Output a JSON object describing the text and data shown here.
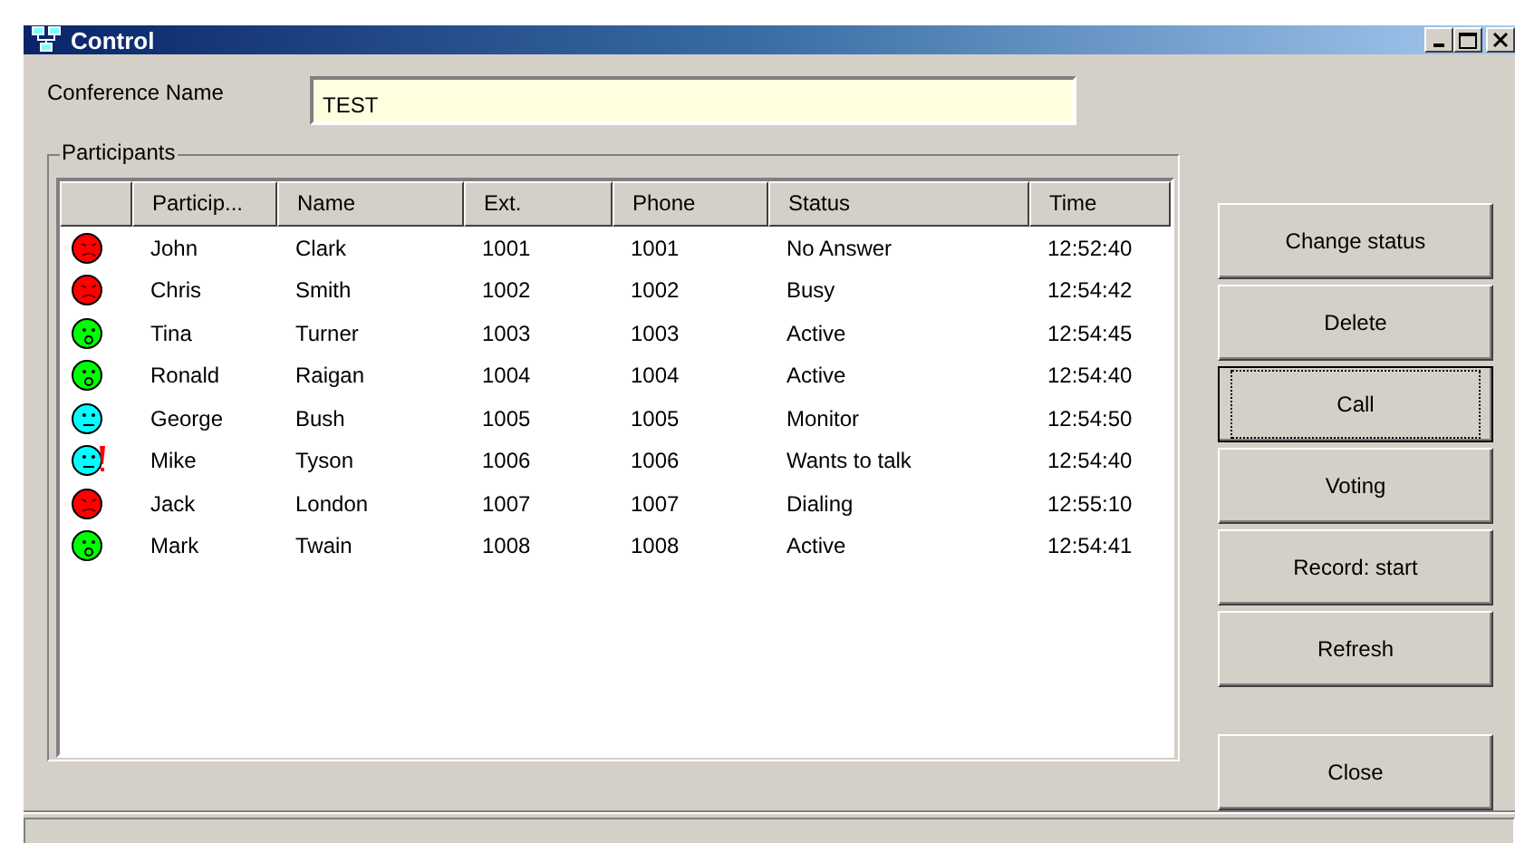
{
  "window": {
    "title": "Control"
  },
  "conference_name": {
    "label": "Conference Name",
    "value": "TEST"
  },
  "participants": {
    "title": "Participants",
    "columns": [
      "Particip...",
      "Name",
      "Ext.",
      "Phone",
      "Status",
      "Time"
    ],
    "rows": [
      {
        "icon": {
          "kind": "sad",
          "color": "#ff0000"
        },
        "cells": [
          "John",
          "Clark",
          "1001",
          "1001",
          "No Answer",
          "12:52:40"
        ]
      },
      {
        "icon": {
          "kind": "sad",
          "color": "#ff0000"
        },
        "cells": [
          "Chris",
          "Smith",
          "1002",
          "1002",
          "Busy",
          "12:54:42"
        ]
      },
      {
        "icon": {
          "kind": "talking",
          "color": "#00ff00"
        },
        "cells": [
          "Tina",
          "Turner",
          "1003",
          "1003",
          "Active",
          "12:54:45"
        ]
      },
      {
        "icon": {
          "kind": "talking",
          "color": "#00ff00"
        },
        "cells": [
          "Ronald",
          "Raigan",
          "1004",
          "1004",
          "Active",
          "12:54:40"
        ]
      },
      {
        "icon": {
          "kind": "neutral",
          "color": "#00ffff"
        },
        "cells": [
          "George",
          "Bush",
          "1005",
          "1005",
          "Monitor",
          "12:54:50"
        ]
      },
      {
        "icon": {
          "kind": "raised",
          "color": "#00ffff"
        },
        "cells": [
          "Mike",
          "Tyson",
          "1006",
          "1006",
          "Wants to talk",
          "12:54:40"
        ]
      },
      {
        "icon": {
          "kind": "sad",
          "color": "#ff0000"
        },
        "cells": [
          "Jack",
          "London",
          "1007",
          "1007",
          "Dialing",
          "12:55:10"
        ]
      },
      {
        "icon": {
          "kind": "talking",
          "color": "#00ff00"
        },
        "cells": [
          "Mark",
          "Twain",
          "1008",
          "1008",
          "Active",
          "12:54:41"
        ]
      }
    ]
  },
  "buttons": [
    {
      "label": "Change status",
      "focused": false
    },
    {
      "label": "Delete",
      "focused": false
    },
    {
      "label": "Call",
      "focused": true
    },
    {
      "label": "Voting",
      "focused": false
    },
    {
      "label": "Record: start",
      "focused": false
    },
    {
      "label": "Refresh",
      "focused": false
    },
    {
      "label": "Close",
      "focused": false
    }
  ]
}
